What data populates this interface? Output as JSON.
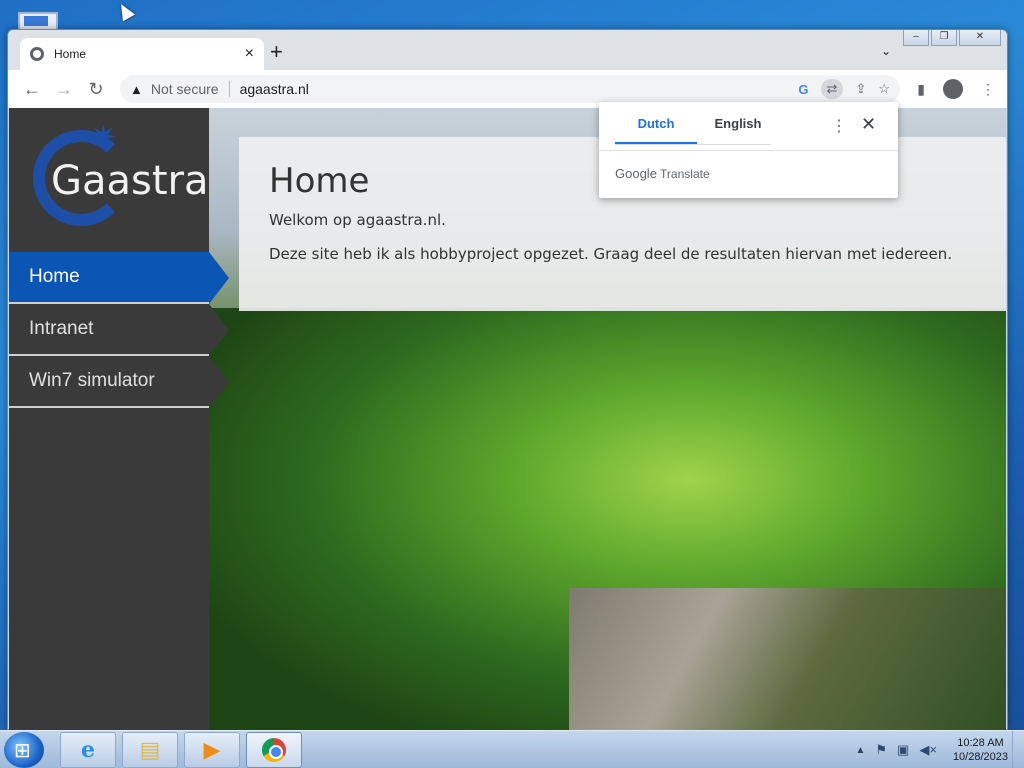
{
  "browser": {
    "tab_title": "Home",
    "new_tab": "+",
    "url_security": "Not secure",
    "url": "agaastra.nl"
  },
  "site": {
    "logo_text": "Gaastra",
    "nav": [
      {
        "label": "Home",
        "active": true
      },
      {
        "label": "Intranet",
        "active": false
      },
      {
        "label": "Win7 simulator",
        "active": false
      }
    ],
    "heading": "Home",
    "welcome": "Welkom op agaastra.nl.",
    "body": "Deze site heb ik als hobbyproject opgezet. Graag deel de resultaten hiervan met iedereen."
  },
  "translate_popup": {
    "tabs": [
      "Dutch",
      "English"
    ],
    "active_tab": "Dutch",
    "brand_google": "Google",
    "brand_translate": "Translate"
  },
  "taskbar": {
    "apps": [
      "internet-explorer",
      "file-explorer",
      "media-player",
      "chrome"
    ],
    "time": "10:28 AM",
    "date": "10/28/2023"
  },
  "colors": {
    "nav_active": "#0b55b5",
    "sidebar": "#3a3a3a",
    "translate_accent": "#1a73e8"
  }
}
